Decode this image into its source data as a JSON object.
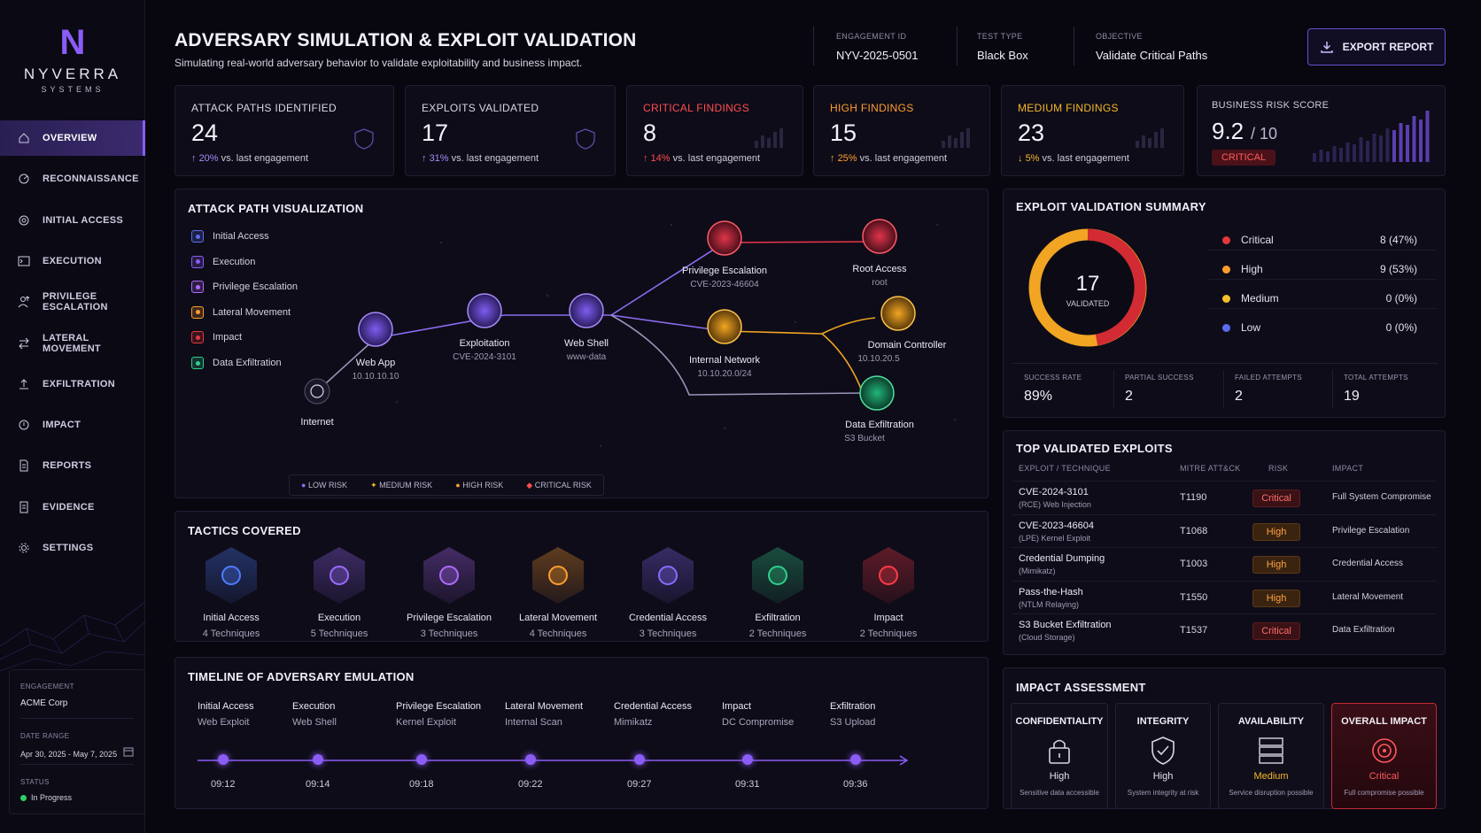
{
  "brand": {
    "mark": "N",
    "name": "NYVERRA",
    "sub": "SYSTEMS"
  },
  "nav": [
    {
      "label": "OVERVIEW",
      "icon": "home-icon",
      "active": true
    },
    {
      "label": "RECONNAISSANCE",
      "icon": "radar-icon"
    },
    {
      "label": "INITIAL ACCESS",
      "icon": "target-icon"
    },
    {
      "label": "EXECUTION",
      "icon": "terminal-icon"
    },
    {
      "label": "PRIVILEGE ESCALATION",
      "icon": "user-up-icon"
    },
    {
      "label": "LATERAL MOVEMENT",
      "icon": "arrows-icon"
    },
    {
      "label": "EXFILTRATION",
      "icon": "upload-icon"
    },
    {
      "label": "IMPACT",
      "icon": "impact-icon"
    },
    {
      "label": "REPORTS",
      "icon": "document-icon"
    },
    {
      "label": "EVIDENCE",
      "icon": "evidence-icon"
    },
    {
      "label": "SETTINGS",
      "icon": "gear-icon"
    }
  ],
  "engagement": {
    "label": "ENGAGEMENT",
    "value": "ACME Corp",
    "date_label": "DATE RANGE",
    "date": "Apr 30, 2025 - May 7, 2025",
    "status_label": "STATUS",
    "status": "In Progress"
  },
  "header": {
    "title": "ADVERSARY SIMULATION & EXPLOIT VALIDATION",
    "subtitle": "Simulating real-world adversary behavior to validate exploitability and business impact.",
    "meta": [
      {
        "label": "ENGAGEMENT ID",
        "value": "NYV-2025-0501"
      },
      {
        "label": "TEST TYPE",
        "value": "Black Box"
      },
      {
        "label": "OBJECTIVE",
        "value": "Validate Critical Paths"
      }
    ],
    "export": "EXPORT REPORT"
  },
  "stats": [
    {
      "label": "ATTACK PATHS IDENTIFIED",
      "value": "24",
      "delta": "20%",
      "delta_text": "vs. last engagement",
      "color": "#d9d6e6",
      "dir": "up",
      "dcolor": "#a78bfa"
    },
    {
      "label": "EXPLOITS VALIDATED",
      "value": "17",
      "delta": "31%",
      "delta_text": "vs. last engagement",
      "color": "#d9d6e6",
      "dir": "up",
      "dcolor": "#a78bfa"
    },
    {
      "label": "CRITICAL FINDINGS",
      "value": "8",
      "delta": "14%",
      "delta_text": "vs. last engagement",
      "color": "#ff4d4f",
      "dir": "up",
      "dcolor": "#ff4d4f"
    },
    {
      "label": "HIGH FINDINGS",
      "value": "15",
      "delta": "25%",
      "delta_text": "vs. last engagement",
      "color": "#ff9d2e",
      "dir": "up",
      "dcolor": "#ff9d2e"
    },
    {
      "label": "MEDIUM FINDINGS",
      "value": "23",
      "delta": "5%",
      "delta_text": "vs. last engagement",
      "color": "#f5b72b",
      "dir": "down",
      "dcolor": "#f5b72b"
    }
  ],
  "risk_score": {
    "label": "BUSINESS RISK SCORE",
    "value": "9.2",
    "max": "/ 10",
    "badge": "CRITICAL"
  },
  "attack_path": {
    "title": "ATTACK PATH VISUALIZATION",
    "legend": [
      "Initial Access",
      "Execution",
      "Privilege Escalation",
      "Lateral Movement",
      "Impact",
      "Data Exfiltration"
    ],
    "nodes": {
      "internet": {
        "label": "Internet"
      },
      "webapp": {
        "label": "Web App",
        "sub": "10.10.10.10"
      },
      "exploit": {
        "label": "Exploitation",
        "sub": "CVE-2024-3101"
      },
      "webshell": {
        "label": "Web Shell",
        "sub": "www-data"
      },
      "privesc": {
        "label": "Privilege Escalation",
        "sub": "CVE-2023-46604"
      },
      "root": {
        "label": "Root Access",
        "sub": "root"
      },
      "internal": {
        "label": "Internal Network",
        "sub": "10.10.20.0/24"
      },
      "dc": {
        "label": "Domain Controller",
        "sub": "10.10.20.5"
      },
      "exfil": {
        "label": "Data Exfiltration",
        "sub": "S3 Bucket"
      }
    },
    "risk_legend": [
      "LOW RISK",
      "MEDIUM RISK",
      "HIGH RISK",
      "CRITICAL RISK"
    ]
  },
  "tactics": {
    "title": "TACTICS COVERED",
    "items": [
      {
        "name": "Initial Access",
        "count": "4 Techniques",
        "color": "#4f7dff",
        "icon": "globe-icon"
      },
      {
        "name": "Execution",
        "count": "5 Techniques",
        "color": "#9b6bff",
        "icon": "tools-icon"
      },
      {
        "name": "Privilege Escalation",
        "count": "3 Techniques",
        "color": "#b06bff",
        "icon": "escalation-icon"
      },
      {
        "name": "Lateral Movement",
        "count": "4 Techniques",
        "color": "#ff9d2e",
        "icon": "movement-icon"
      },
      {
        "name": "Credential Access",
        "count": "3 Techniques",
        "color": "#8a6bff",
        "icon": "key-icon"
      },
      {
        "name": "Exfiltration",
        "count": "2 Techniques",
        "color": "#2fcf8a",
        "icon": "exfil-icon"
      },
      {
        "name": "Impact",
        "count": "2 Techniques",
        "color": "#ff3b47",
        "icon": "impact-icon"
      }
    ]
  },
  "timeline": {
    "title": "TIMELINE OF ADVERSARY EMULATION",
    "events": [
      {
        "name": "Initial Access",
        "detail": "Web Exploit",
        "time": "09:12"
      },
      {
        "name": "Execution",
        "detail": "Web Shell",
        "time": "09:14"
      },
      {
        "name": "Privilege Escalation",
        "detail": "Kernel Exploit",
        "time": "09:18"
      },
      {
        "name": "Lateral Movement",
        "detail": "Internal Scan",
        "time": "09:22"
      },
      {
        "name": "Credential Access",
        "detail": "Mimikatz",
        "time": "09:27"
      },
      {
        "name": "Impact",
        "detail": "DC Compromise",
        "time": "09:31"
      },
      {
        "name": "Exfiltration",
        "detail": "S3 Upload",
        "time": "09:36"
      }
    ]
  },
  "summary": {
    "title": "EXPLOIT VALIDATION SUMMARY",
    "center_value": "17",
    "center_label": "VALIDATED",
    "items": [
      {
        "label": "Critical",
        "count": "8 (47%)",
        "color": "#e5383b"
      },
      {
        "label": "High",
        "count": "9 (53%)",
        "color": "#ff9d2e"
      },
      {
        "label": "Medium",
        "count": "0 (0%)",
        "color": "#f5c02b"
      },
      {
        "label": "Low",
        "count": "0 (0%)",
        "color": "#5b6cf0"
      }
    ],
    "stats": [
      {
        "label": "SUCCESS RATE",
        "value": "89%"
      },
      {
        "label": "PARTIAL SUCCESS",
        "value": "2"
      },
      {
        "label": "FAILED ATTEMPTS",
        "value": "2"
      },
      {
        "label": "TOTAL ATTEMPTS",
        "value": "19"
      }
    ]
  },
  "exploits": {
    "title": "TOP VALIDATED EXPLOITS",
    "columns": [
      "EXPLOIT / TECHNIQUE",
      "MITRE ATT&CK",
      "RISK",
      "IMPACT"
    ],
    "rows": [
      {
        "name": "CVE-2024-3101",
        "sub": "(RCE) Web Injection",
        "mitre": "T1190",
        "risk": "Critical",
        "impact": "Full System Compromise"
      },
      {
        "name": "CVE-2023-46604",
        "sub": "(LPE) Kernel Exploit",
        "mitre": "T1068",
        "risk": "High",
        "impact": "Privilege Escalation"
      },
      {
        "name": "Credential Dumping",
        "sub": "(Mimikatz)",
        "mitre": "T1003",
        "risk": "High",
        "impact": "Credential Access"
      },
      {
        "name": "Pass-the-Hash",
        "sub": "(NTLM Relaying)",
        "mitre": "T1550",
        "risk": "High",
        "impact": "Lateral Movement"
      },
      {
        "name": "S3 Bucket Exfiltration",
        "sub": "(Cloud Storage)",
        "mitre": "T1537",
        "risk": "Critical",
        "impact": "Data Exfiltration"
      }
    ]
  },
  "impact": {
    "title": "IMPACT ASSESSMENT",
    "items": [
      {
        "label": "CONFIDENTIALITY",
        "value": "High",
        "sub": "Sensitive data accessible",
        "icon": "lock-icon",
        "color": "#e6e4f0"
      },
      {
        "label": "INTEGRITY",
        "value": "High",
        "sub": "System integrity at risk",
        "icon": "shield-icon",
        "color": "#e6e4f0"
      },
      {
        "label": "AVAILABILITY",
        "value": "Medium",
        "sub": "Service disruption possible",
        "icon": "server-icon",
        "color": "#f5b72b"
      },
      {
        "label": "OVERALL IMPACT",
        "value": "Critical",
        "sub": "Full compromise possible",
        "icon": "target-icon",
        "color": "#ff5a5f"
      }
    ]
  }
}
